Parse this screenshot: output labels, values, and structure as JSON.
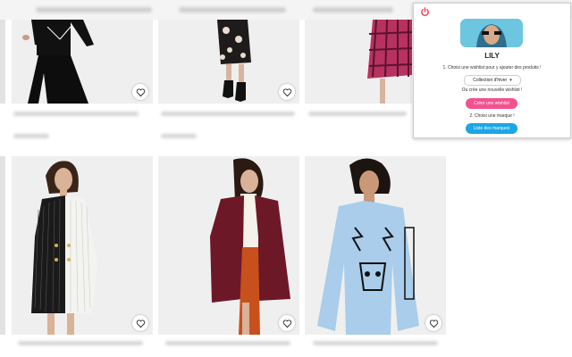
{
  "popup": {
    "username": "LILY",
    "step1": "1. Choisi une wishlist pour y ajouter des produits !",
    "select_value": "Collection d'hiver",
    "or_text": "Ou crée une nouvelle wishlist !",
    "create_button": "Créer une wishlist",
    "step2": "2. Choisi une marque !",
    "brands_button": "Liste des marques"
  },
  "products": [
    {
      "id": "top-1",
      "description": "black jumpsuit with white trim"
    },
    {
      "id": "top-2",
      "description": "floral skirt with black boots"
    },
    {
      "id": "top-3",
      "description": "pink tartan dress"
    },
    {
      "id": "bottom-1",
      "description": "black and white pinstripe blazer dress"
    },
    {
      "id": "bottom-2",
      "description": "burgundy teddy coat with orange skirt"
    },
    {
      "id": "bottom-3",
      "description": "blue graphic sweatshirt"
    }
  ],
  "colors": {
    "pink": "#f2528e",
    "blue": "#1aa7e4",
    "power": "#e8364b"
  }
}
